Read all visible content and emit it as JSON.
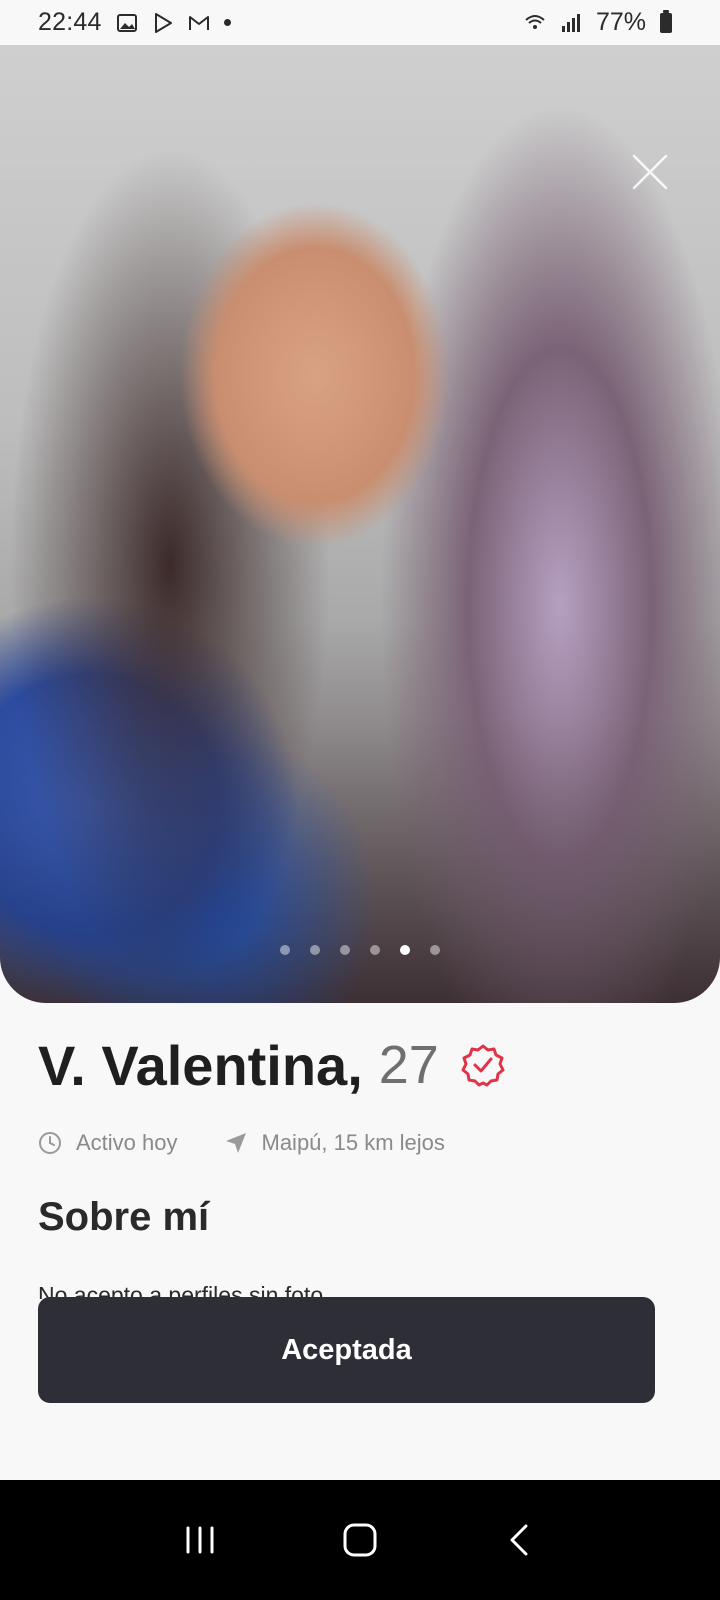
{
  "status_bar": {
    "time": "22:44",
    "battery": "77%",
    "icons": [
      "gallery-icon",
      "play-store-icon",
      "gmail-icon",
      "notification-dot",
      "wifi-icon",
      "signal-icon",
      "battery-icon"
    ]
  },
  "photo": {
    "dots_total": 6,
    "dots_active_index": 4
  },
  "profile": {
    "name": "V. Valentina,",
    "age": "27",
    "activity": "Activo hoy",
    "location": "Maipú, 15 km lejos"
  },
  "about": {
    "title": "Sobre mí",
    "text": "No acepto a perfiles sin foto"
  },
  "actions": {
    "accept_label": "Aceptada"
  },
  "colors": {
    "verified_badge": "#e0334a",
    "button_bg": "#2e2f36",
    "text_primary": "#1f1f1f",
    "text_secondary": "#8a8a8a"
  },
  "navigation": {
    "buttons": [
      "recents-icon",
      "home-icon",
      "back-icon"
    ]
  }
}
